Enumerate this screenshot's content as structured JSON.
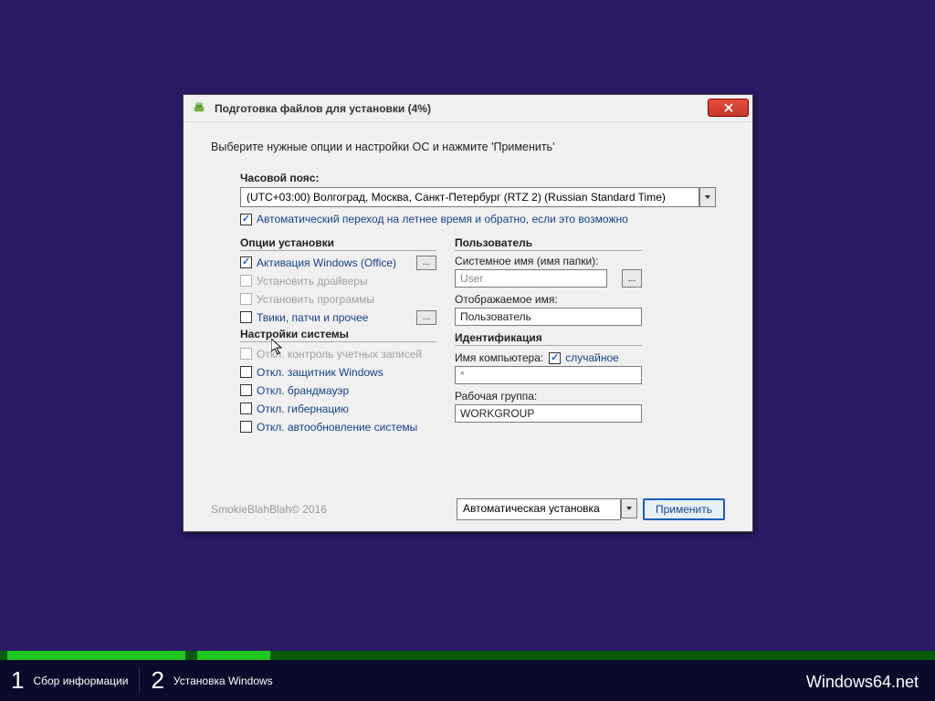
{
  "title": "Подготовка файлов для установки (4%)",
  "instruction": "Выберите нужные опции и настройки ОС и нажмите 'Применить'",
  "tz": {
    "label": "Часовой пояс:",
    "value": "(UTC+03:00) Волгоград, Москва, Санкт-Петербург (RTZ 2) (Russian Standard Time)",
    "dst": "Автоматический переход на летнее время и обратно, если это возможно"
  },
  "install_opts": {
    "title": "Опции установки",
    "activate": "Активация Windows (Office)",
    "drivers": "Установить драйверы",
    "programs": "Установить программы",
    "tweaks": "Твики, патчи и прочее"
  },
  "sys_settings": {
    "title": "Настройки системы",
    "uac": "Откл. контроль учетных записей",
    "defender": "Откл. защитник Windows",
    "firewall": "Откл. брандмауэр",
    "hibernate": "Откл. гибернацию",
    "updates": "Откл. автообновление системы"
  },
  "user": {
    "title": "Пользователь",
    "sysname_label": "Системное имя (имя папки):",
    "sysname_value": "User",
    "display_label": "Отображаемое имя:",
    "display_value": "Пользователь"
  },
  "ident": {
    "title": "Идентификация",
    "pcname_label": "Имя компьютера:",
    "random_label": "случайное",
    "pcname_value": "*",
    "workgroup_label": "Рабочая группа:",
    "workgroup_value": "WORKGROUP"
  },
  "footer": {
    "copyright": "SmokieBlahBlah© 2016",
    "mode": "Автоматическая установка",
    "apply": "Применить"
  },
  "steps": {
    "s1": "Сбор информации",
    "s2": "Установка Windows"
  },
  "watermark": "Windows64.net"
}
